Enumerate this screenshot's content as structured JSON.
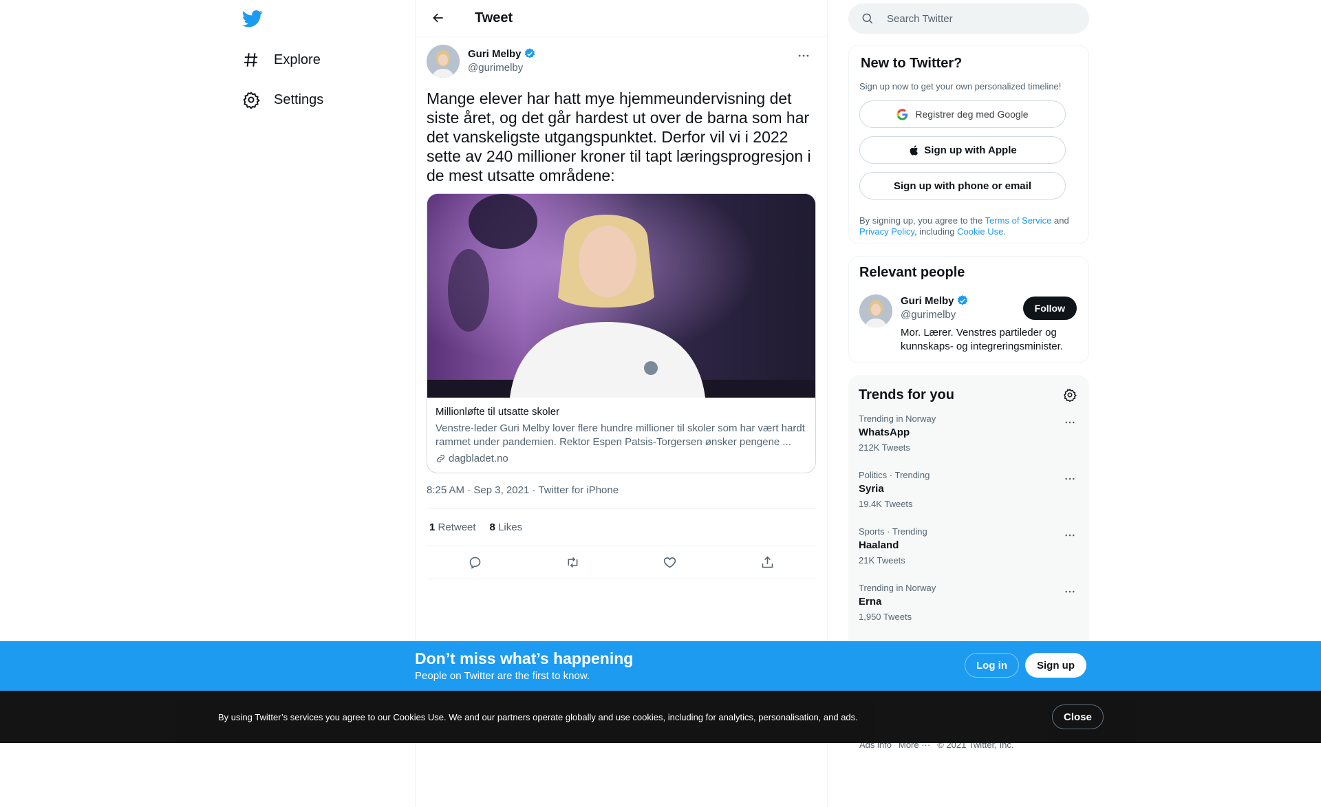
{
  "nav": {
    "logo": "twitter-bird-icon",
    "items": [
      {
        "label": "Explore",
        "icon": "hashtag-icon"
      },
      {
        "label": "Settings",
        "icon": "gear-icon"
      }
    ]
  },
  "header": {
    "title": "Tweet"
  },
  "tweet": {
    "author_name": "Guri Melby",
    "author_handle": "@gurimelby",
    "text": "Mange elever har hatt mye hjemmeundervisning det siste året, og det går hardest ut over de barna som har det vanskeligste utgangspunktet. Derfor vil vi i 2022 sette av 240 millioner kroner til tapt læringsprogresjon i de mest utsatte områdene:",
    "card": {
      "title": "Millionløfte til utsatte skoler",
      "description": "Venstre-leder Guri Melby lover flere hundre millioner til skoler som har vært hardt rammet under pandemien. Rektor Espen Patsis-Torgersen ønsker pengene ...",
      "domain": "dagbladet.no"
    },
    "meta": {
      "time": "8:25 AM",
      "sep": " · ",
      "date": "Sep 3, 2021",
      "source": "Twitter for iPhone"
    },
    "stats": {
      "retweets": "1",
      "retweets_label": "Retweet",
      "likes": "8",
      "likes_label": "Likes"
    }
  },
  "search": {
    "placeholder": "Search Twitter"
  },
  "new_to_twitter": {
    "title": "New to Twitter?",
    "subtitle": "Sign up now to get your own personalized timeline!",
    "google_label": "Registrer deg med Google",
    "apple_label": "Sign up with Apple",
    "phone_label": "Sign up with phone or email",
    "terms_pre": "By signing up, you agree to the ",
    "terms_link": "Terms of Service",
    "terms_and": " and",
    "privacy_link": "Privacy Policy",
    "terms_including": ", including ",
    "cookie_link": "Cookie Use."
  },
  "relevant": {
    "title": "Relevant people",
    "name": "Guri Melby",
    "handle": "@gurimelby",
    "bio": "Mor. Lærer. Venstres partileder og kunnskaps- og integreringsminister.",
    "follow_label": "Follow"
  },
  "trends": {
    "title": "Trends for you",
    "items": [
      {
        "context": "Trending in Norway",
        "name": "WhatsApp",
        "count": "212K Tweets"
      },
      {
        "context": "Politics · Trending",
        "name": "Syria",
        "count": "19.4K Tweets"
      },
      {
        "context": "Sports · Trending",
        "name": "Haaland",
        "count": "21K Tweets"
      },
      {
        "context": "Trending in Norway",
        "name": "Erna",
        "count": "1,950 Tweets"
      }
    ]
  },
  "footer": {
    "ads": "Ads info",
    "more": "More ···",
    "copyright": "© 2021 Twitter, Inc."
  },
  "signup_bar": {
    "headline": "Don’t miss what’s happening",
    "subtitle": "People on Twitter are the first to know.",
    "login_label": "Log in",
    "signup_label": "Sign up"
  },
  "cookie_bar": {
    "text": "By using Twitter’s services you agree to our Cookies Use. We and our partners operate globally and use cookies, including for analytics, personalisation, and ads.",
    "close_label": "Close"
  },
  "colors": {
    "accent": "#1d9bf0",
    "text": "#0f1419",
    "muted": "#536471"
  }
}
